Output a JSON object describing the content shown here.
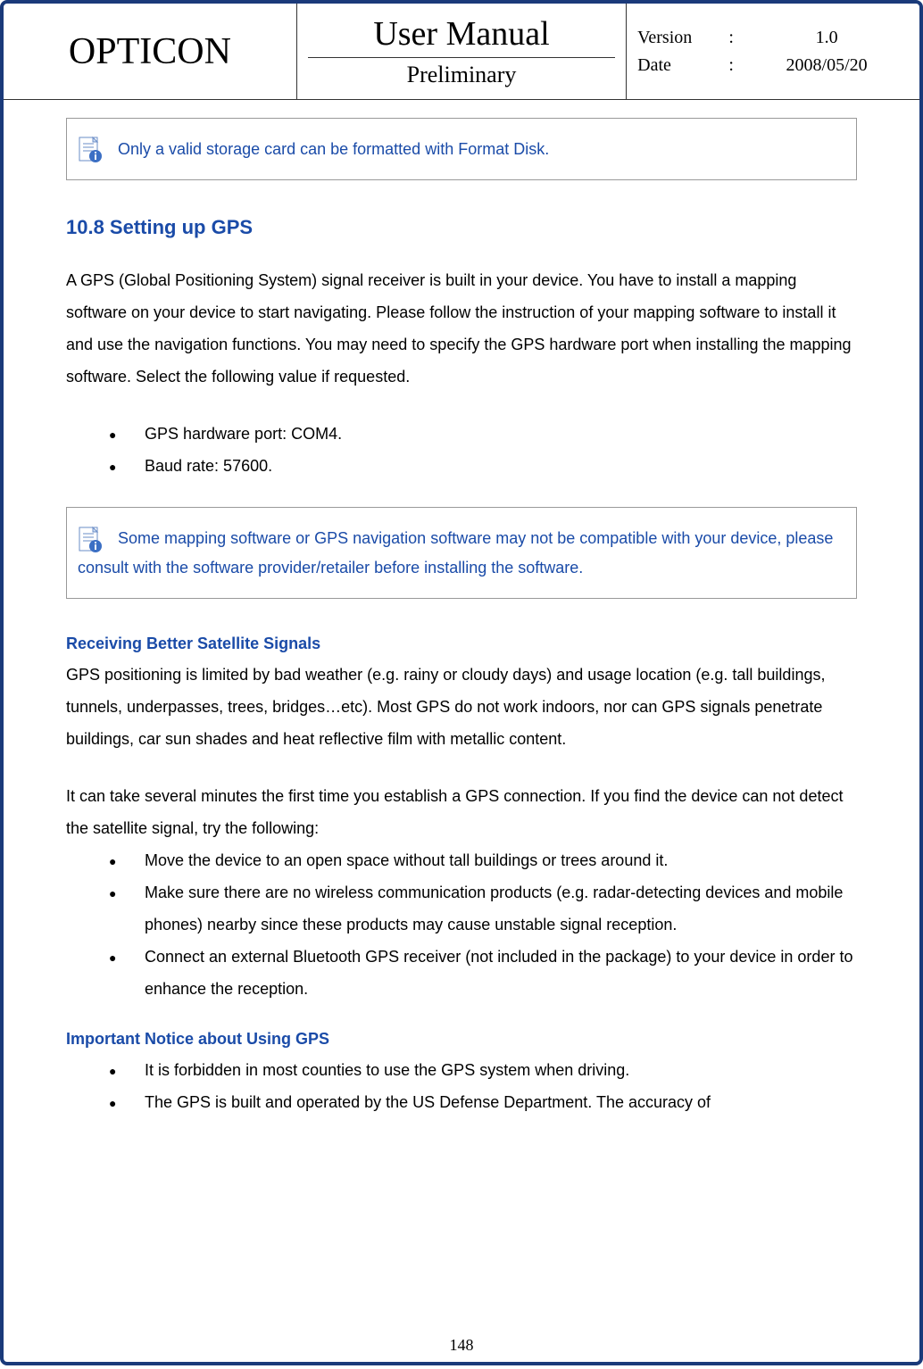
{
  "header": {
    "brand": "OPTICON",
    "title": "User Manual",
    "subtitle": "Preliminary",
    "version_label": "Version",
    "version_value": "1.0",
    "date_label": "Date",
    "date_value": "2008/05/20"
  },
  "notes": {
    "note1": "Only a valid storage card can be formatted with Format Disk.",
    "note2": "Some mapping software or GPS navigation software may not be compatible with your device, please consult with the software provider/retailer before installing the software."
  },
  "section": {
    "heading": "10.8 Setting up GPS",
    "intro": "A GPS (Global Positioning System) signal receiver is built in your device. You have to install a mapping software on your device to start navigating. Please follow the instruction of your mapping software to install it and use the navigation functions. You may need to specify the GPS hardware port when installing the mapping software. Select the following value if requested.",
    "bullets1": [
      "GPS hardware port: COM4.",
      "Baud rate: 57600."
    ],
    "sub1_heading": "Receiving Better Satellite Signals",
    "sub1_p1": "GPS positioning is limited by bad weather (e.g. rainy or cloudy days) and usage location (e.g. tall buildings, tunnels, underpasses, trees, bridges…etc). Most GPS do not work indoors, nor can GPS signals penetrate buildings, car sun shades and heat reflective film with metallic content.",
    "sub1_p2": "It can take several minutes the first time you establish a GPS connection. If you find the device can not detect the satellite signal, try the following:",
    "bullets2": [
      "Move the device to an open space without tall buildings or trees around it.",
      "Make sure there are no wireless communication products (e.g. radar-detecting devices and mobile phones) nearby since these products may cause unstable signal reception.",
      "Connect an external Bluetooth GPS receiver (not included in the package) to your device in order to enhance the reception."
    ],
    "sub2_heading": "Important Notice about Using GPS",
    "bullets3": [
      "It is forbidden in most counties to use the GPS system when driving.",
      "The GPS is built and operated by the US Defense Department. The accuracy of"
    ]
  },
  "page_number": "148"
}
